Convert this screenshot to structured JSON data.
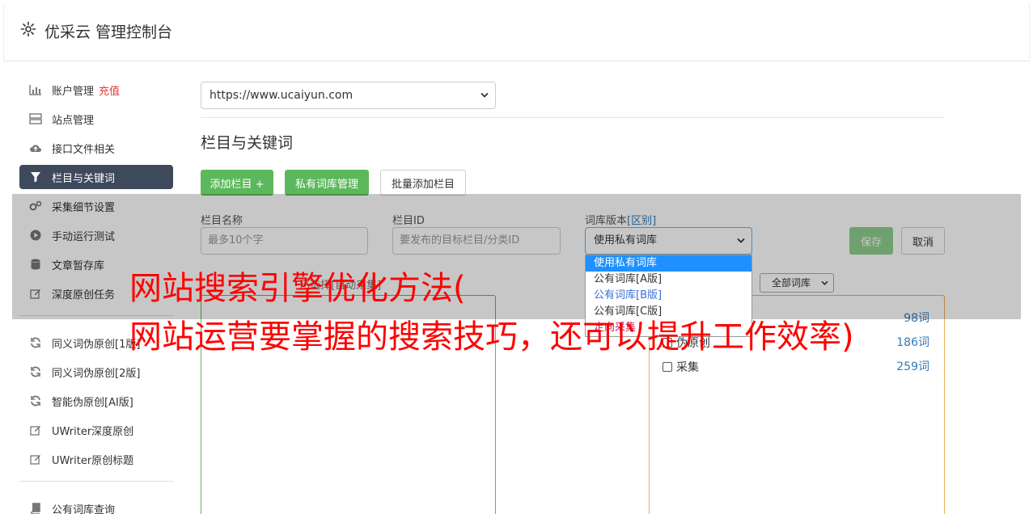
{
  "header": {
    "title": "优采云 管理控制台",
    "icon": "gear-icon"
  },
  "sidebar": {
    "items": [
      {
        "label": "账户管理",
        "extra": "充值",
        "icon": "bar-chart-icon"
      },
      {
        "label": "站点管理",
        "icon": "server-icon"
      },
      {
        "label": "接口文件相关",
        "icon": "cloud-upload-icon"
      },
      {
        "label": "栏目与关键词",
        "icon": "filter-icon",
        "active": true
      },
      {
        "label": "采集细节设置",
        "icon": "cogs-icon"
      },
      {
        "label": "手动运行测试",
        "icon": "play-circle-icon"
      },
      {
        "label": "文章暂存库",
        "icon": "database-icon"
      },
      {
        "label": "深度原创任务",
        "icon": "edit-icon"
      }
    ],
    "items2": [
      {
        "label": "同义词伪原创[1版]",
        "icon": "refresh-icon"
      },
      {
        "label": "同义词伪原创[2版]",
        "icon": "refresh-icon"
      },
      {
        "label": "智能伪原创[AI版]",
        "icon": "refresh-icon"
      },
      {
        "label": "UWriter深度原创",
        "icon": "edit-icon"
      },
      {
        "label": "UWriter原创标题",
        "icon": "edit-icon"
      }
    ],
    "items3": [
      {
        "label": "公有词库查询",
        "icon": "book-icon"
      }
    ]
  },
  "main": {
    "site_select": "https://www.ucaiyun.com",
    "section_title": "栏目与关键词",
    "buttons": {
      "add": "添加栏目 +",
      "private_lib": "私有词库管理",
      "batch_add": "批量添加栏目"
    },
    "form": {
      "name_label": "栏目名称",
      "name_placeholder": "最多10个字",
      "id_label": "栏目ID",
      "id_placeholder": "要发布的目标栏目/分类ID",
      "version_label": "词库版本",
      "version_label_link": "[区别]",
      "version_value": "使用私有词库",
      "save": "保存",
      "cancel": "取消"
    },
    "dropdown_options": [
      "使用私有词库",
      "公有词库[A版]",
      "公有词库[B版]",
      "公有词库[C版]",
      "定向采集"
    ],
    "filter_select": "全部词库",
    "left_panel_header": "已选择[自动采集]",
    "libraries": [
      {
        "name": "",
        "count": "98词"
      },
      {
        "name": "伪原创",
        "count": "186词"
      },
      {
        "name": "采集",
        "count": "259词"
      }
    ]
  },
  "watermark": {
    "line1": "网站搜索引擎优化方法(",
    "line2": "网站运营要掌握的搜索技巧，还可以提升工作效率)"
  },
  "colors": {
    "accent_green": "#5cb85c",
    "active_nav": "#3e4a5c",
    "danger_red": "#e53935",
    "link_blue": "#337ab7",
    "warning_orange": "#f0ad4e"
  }
}
